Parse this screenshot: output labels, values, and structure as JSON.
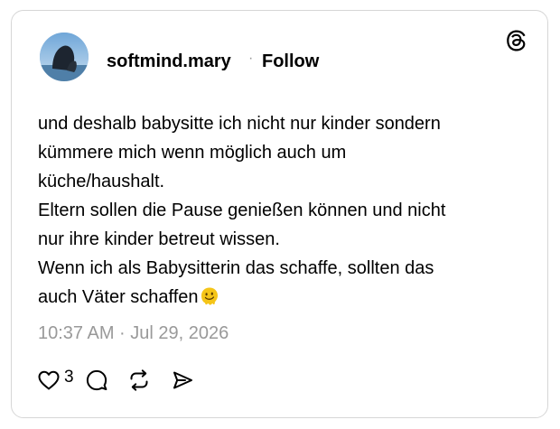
{
  "post": {
    "author": "softmind.mary",
    "separator": "·",
    "follow_label": "Follow",
    "text_lines": [
      "und deshalb babysitte ich nicht nur kinder sondern",
      "kümmere mich wenn möglich auch um",
      "küche/haushalt.",
      "Eltern sollen die Pause genießen können und nicht",
      "nur ihre kinder betreut wissen.",
      "Wenn ich als Babysitterin das schaffe, sollten das",
      "auch Väter schaffen"
    ],
    "timestamp": "10:37 AM · Jul 29, 2026",
    "like_count": "3"
  },
  "icons": {
    "brand": "threads-logo-icon",
    "like": "heart-icon",
    "reply": "comment-icon",
    "repost": "repost-icon",
    "share": "send-icon",
    "emoji": "melting-face-emoji"
  },
  "colors": {
    "text": "#000000",
    "muted": "#999999",
    "border": "#d6d6d6",
    "emoji": "#f5c518"
  }
}
